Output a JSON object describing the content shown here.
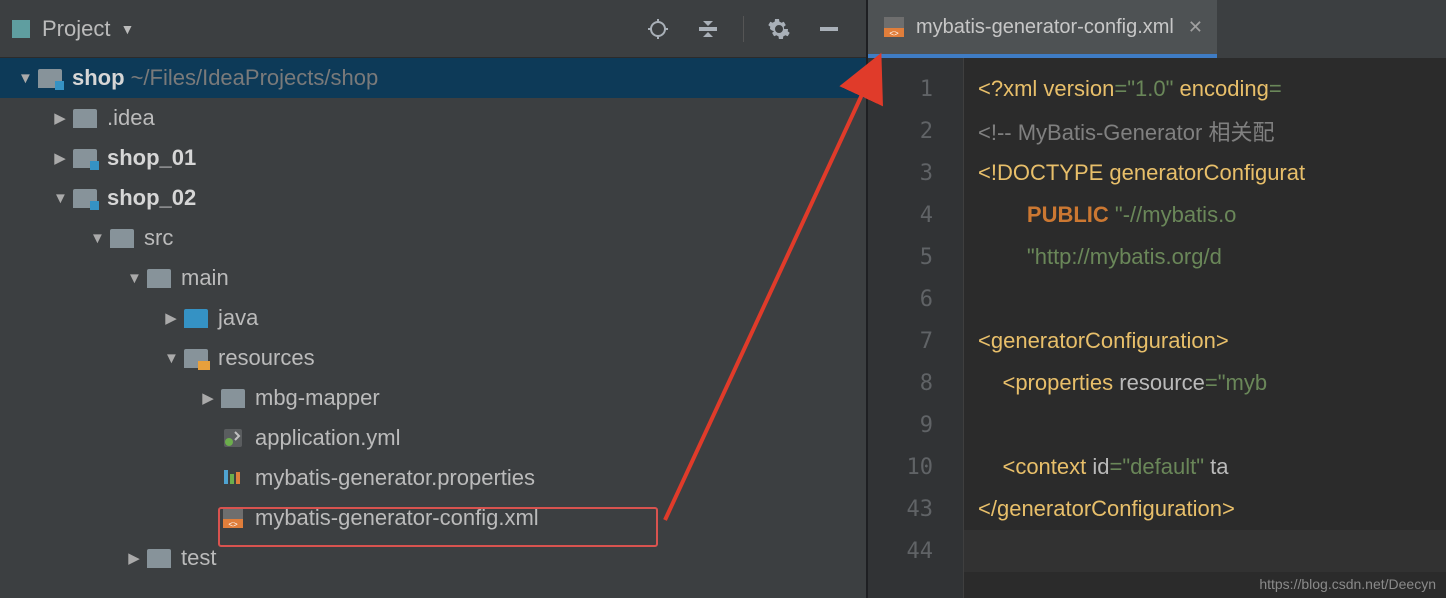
{
  "header": {
    "label": "Project"
  },
  "tree": {
    "root": {
      "name": "shop",
      "path": "~/Files/IdeaProjects/shop"
    },
    "idea": ".idea",
    "shop01": "shop_01",
    "shop02": "shop_02",
    "src": "src",
    "main": "main",
    "java": "java",
    "resources": "resources",
    "mbg": "mbg-mapper",
    "appyml": "application.yml",
    "props": "mybatis-generator.properties",
    "cfgxml": "mybatis-generator-config.xml",
    "test": "test"
  },
  "tab": {
    "label": "mybatis-generator-config.xml"
  },
  "gutter": [
    "1",
    "2",
    "3",
    "4",
    "5",
    "6",
    "7",
    "8",
    "9",
    "10",
    "43",
    "44"
  ],
  "code": {
    "l1a": "<?",
    "l1b": "xml version",
    "l1c": "=",
    "l1d": "\"1.0\"",
    "l1e": " encoding",
    "l1f": "=",
    "l2": "<!-- MyBatis-Generator 相关配",
    "l3a": "<!DOCTYPE ",
    "l3b": "generatorConfigurat",
    "l4a": "PUBLIC ",
    "l4b": "\"-//mybatis.o",
    "l5": "\"http://mybatis.org/d",
    "l7": "generatorConfiguration",
    "l7b": ">",
    "l8a": "properties ",
    "l8b": "resource",
    "l8c": "=",
    "l8d": "\"myb",
    "l10a": "context ",
    "l10b": "id",
    "l10c": "=",
    "l10d": "\"default\"",
    "l10e": " ta",
    "l43a": "</",
    "l43b": "generatorConfiguration",
    "l43c": ">",
    "open": "<"
  },
  "watermark": "https://blog.csdn.net/Deecyn"
}
